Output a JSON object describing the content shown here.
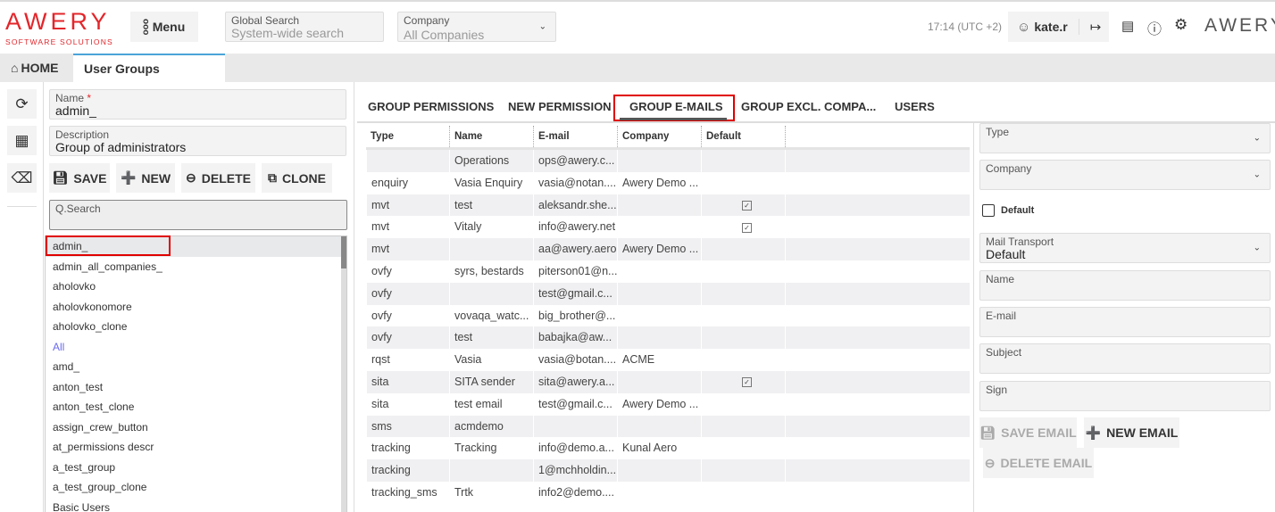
{
  "header": {
    "logo": "AWERY",
    "logo_sub": "SOFTWARE SOLUTIONS",
    "menu_label": "Menu",
    "global_search_label": "Global Search",
    "global_search_placeholder": "System-wide search",
    "company_label": "Company",
    "company_value": "All Companies",
    "time": "17:14 (UTC +2)",
    "user": "kate.r",
    "brand_right": "AWERY"
  },
  "tabs": {
    "home": "HOME",
    "active": "User Groups"
  },
  "form": {
    "name_label": "Name",
    "required_mark": "*",
    "name_value": "admin_",
    "description_label": "Description",
    "description_value": "Group of administrators",
    "save": "SAVE",
    "new": "NEW",
    "delete": "DELETE",
    "clone": "CLONE",
    "search_label": "Q.Search"
  },
  "groups": [
    "admin_",
    "admin_all_companies_",
    "aholovko",
    "aholovkonomore",
    "aholovko_clone",
    "All",
    "amd_",
    "anton_test",
    "anton_test_clone",
    "assign_crew_button",
    "at_permissions descr",
    "a_test_group",
    "a_test_group_clone",
    "Basic Users_"
  ],
  "main_tabs": [
    "GROUP PERMISSIONS",
    "NEW PERMISSION",
    "GROUP E-MAILS",
    "GROUP EXCL. COMPA...",
    "USERS"
  ],
  "active_main_tab": "GROUP E-MAILS",
  "grid": {
    "columns": [
      "Type",
      "Name",
      "E-mail",
      "Company",
      "Default"
    ],
    "rows": [
      [
        "",
        "Operations",
        "ops@awery.c...",
        "",
        false
      ],
      [
        "enquiry",
        "Vasia Enquiry",
        "vasia@notan....",
        "Awery Demo ...",
        false
      ],
      [
        "mvt",
        "test",
        "aleksandr.she...",
        "",
        true
      ],
      [
        "mvt",
        "Vitaly",
        "info@awery.net",
        "",
        true
      ],
      [
        "mvt",
        "",
        "aa@awery.aero",
        "Awery Demo ...",
        false
      ],
      [
        "ovfy",
        "syrs, bestards",
        "piterson01@n...",
        "",
        false
      ],
      [
        "ovfy",
        "",
        "test@gmail.c...",
        "",
        false
      ],
      [
        "ovfy",
        "vovaqa_watc...",
        "big_brother@...",
        "",
        false
      ],
      [
        "ovfy",
        "test",
        "babajka@aw...",
        "",
        false
      ],
      [
        "rqst",
        "Vasia",
        "vasia@botan....",
        "ACME",
        false
      ],
      [
        "sita",
        "SITA sender",
        "sita@awery.a...",
        "",
        true
      ],
      [
        "sita",
        "test email",
        "test@gmail.c...",
        "Awery Demo ...",
        false
      ],
      [
        "sms",
        "acmdemo",
        "",
        "",
        false
      ],
      [
        "tracking",
        "Tracking",
        "info@demo.a...",
        "Kunal Aero",
        false
      ],
      [
        "tracking",
        "",
        "1@mchholdin...",
        "",
        false
      ],
      [
        "tracking_sms",
        "Trtk",
        "info2@demo....",
        "",
        false
      ]
    ]
  },
  "email_form": {
    "type_label": "Type",
    "company_label": "Company",
    "default_label": "Default",
    "default_checked": false,
    "transport_label": "Mail Transport",
    "transport_value": "Default",
    "name_label": "Name",
    "email_label": "E-mail",
    "subject_label": "Subject",
    "sign_label": "Sign",
    "save_email": "SAVE EMAIL",
    "new_email": "NEW EMAIL",
    "delete_email": "DELETE EMAIL"
  },
  "colors": {
    "brand": "#e3262b",
    "highlight": "#e00000",
    "link": "#6a6af0"
  }
}
